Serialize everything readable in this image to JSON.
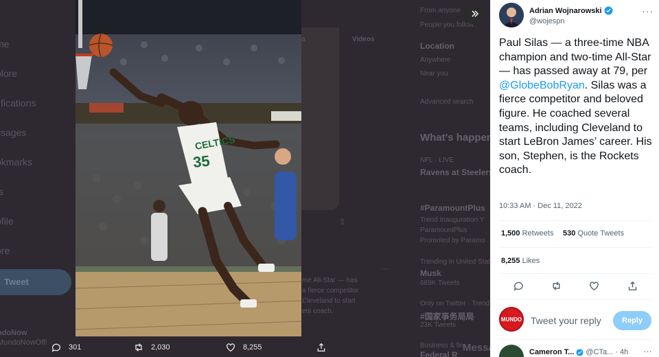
{
  "background": {
    "nav_items": [
      "me",
      "plore",
      "tifications",
      "ssages",
      "okmarks",
      "ts",
      "ofile",
      "ore"
    ],
    "tweet_button": "Tweet",
    "bottom_user_name": "ndoNow",
    "bottom_user_handle": "MundoNowOffi",
    "center_tab": "Videos",
    "center_tab_left": "a",
    "center_text_lines": [
      "me All-Star — has",
      "a fierce competitor",
      "Cleveland to start",
      "ets coach."
    ],
    "right_col": {
      "from": "From anyone",
      "people": "People you follow",
      "location_header": "Location",
      "anywhere": "Anywhere",
      "near_you": "Near you",
      "advanced": "Advanced search",
      "whats_happening": "What's happen",
      "nfl_meta": "NFL · LIVE",
      "nfl_title": "Ravens at Steelers",
      "trend1": "#ParamountPlus",
      "trend1_sub1": "Trend Inauguration Y",
      "trend1_sub2": "ParamountPlus",
      "trend1_promo": "Promoted by Paramo",
      "trend2_meta": "Trending in United Stat",
      "trend2": "Musk",
      "trend2_count": "689K Tweets",
      "trend3_meta": "Only on Twitter · Trend",
      "trend3": "#国家亊务局局",
      "trend3_count": "23K Tweets",
      "trend4_meta": "Business & fin",
      "trend4": "Federal R",
      "messages": "Messa"
    }
  },
  "media_actions": {
    "replies": "301",
    "retweets": "2,030",
    "likes": "8,255"
  },
  "tweet": {
    "author_name": "Adrian Wojnarowski",
    "author_handle": "@wojespn",
    "text_before_mention": "Paul Silas — a three-time NBA champion and two-time All-Star — has passed away at 79, per ",
    "mention": "@GlobeBobRyan",
    "text_after_mention": ". Silas was a fierce competitor and beloved figure. He coached several teams, including Cleveland to start LeBron James’ career. His son, Stephen, is the Rockets coach.",
    "timestamp": "10:33 AM · Dec 11, 2022",
    "retweets_count": "1,500",
    "retweets_label": "Retweets",
    "quotes_count": "530",
    "quotes_label": "Quote Tweets",
    "likes_count": "8,255",
    "likes_label": "Likes",
    "jersey_number": "35",
    "jersey_text": "CELTICS"
  },
  "reply_box": {
    "avatar_text": "MUNDO",
    "placeholder": "Tweet your reply",
    "button": "Reply"
  },
  "next_reply": {
    "name": "Cameron T...",
    "handle": "@CTa...",
    "time": "· 4h"
  },
  "colors": {
    "accent": "#1d9bf0",
    "reply_button": "#8ecdf8",
    "text": "#0f1419",
    "muted": "#536471"
  }
}
